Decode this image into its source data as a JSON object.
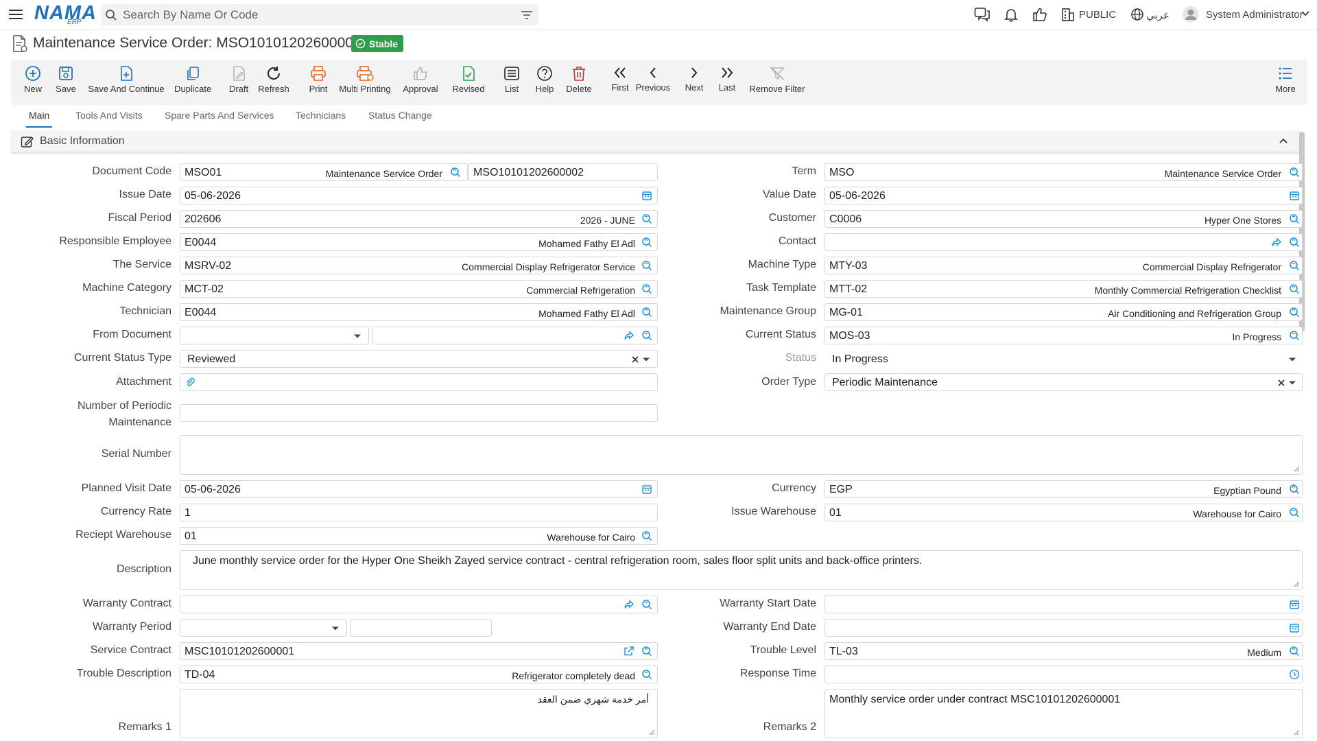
{
  "header": {
    "logo": "NAMA",
    "logo_sub": "ERP",
    "search_placeholder": "Search By Name Or Code",
    "public_label": "PUBLIC",
    "language_label": "عربي",
    "user_name": "System Administrator"
  },
  "page": {
    "title": "Maintenance Service Order: MSO10101202600002",
    "status": "Stable"
  },
  "toolbar": {
    "new": "New",
    "save": "Save",
    "save_continue": "Save And Continue",
    "duplicate": "Duplicate",
    "draft": "Draft",
    "refresh": "Refresh",
    "print": "Print",
    "multi_print": "Multi Printing",
    "approval": "Approval",
    "revised": "Revised",
    "list": "List",
    "help": "Help",
    "delete": "Delete",
    "first": "First",
    "previous": "Previous",
    "next": "Next",
    "last": "Last",
    "remove_filter": "Remove Filter",
    "more": "More"
  },
  "tabs": [
    "Main",
    "Tools And Visits",
    "Spare Parts And Services",
    "Technicians",
    "Status Change"
  ],
  "section": {
    "title": "Basic Information"
  },
  "form": {
    "document_code": {
      "label": "Document Code",
      "code": "MSO01",
      "desc": "Maintenance Service Order",
      "number": "MSO10101202600002"
    },
    "issue_date": {
      "label": "Issue Date",
      "value": "05-06-2026"
    },
    "fiscal_period": {
      "label": "Fiscal Period",
      "code": "202606",
      "desc": "2026 - JUNE"
    },
    "responsible_employee": {
      "label": "Responsible Employee",
      "code": "E0044",
      "desc": "Mohamed Fathy El Adl"
    },
    "the_service": {
      "label": "The Service",
      "code": "MSRV-02",
      "desc": "Commercial Display Refrigerator Service"
    },
    "machine_category": {
      "label": "Machine Category",
      "code": "MCT-02",
      "desc": "Commercial Refrigeration"
    },
    "technician": {
      "label": "Technician",
      "code": "E0044",
      "desc": "Mohamed Fathy El Adl"
    },
    "from_document": {
      "label": "From Document"
    },
    "current_status_type": {
      "label": "Current Status Type",
      "value": "Reviewed"
    },
    "attachment": {
      "label": "Attachment"
    },
    "periodic_maintenance": {
      "label": "Number of Periodic Maintenance"
    },
    "serial_number": {
      "label": "Serial Number"
    },
    "planned_visit_date": {
      "label": "Planned Visit Date",
      "value": "05-06-2026"
    },
    "currency_rate": {
      "label": "Currency Rate",
      "value": "1"
    },
    "receipt_warehouse": {
      "label": "Reciept Warehouse",
      "code": "01",
      "desc": "Warehouse for Cairo"
    },
    "description": {
      "label": "Description",
      "value": "June monthly service order for the Hyper One Sheikh Zayed service contract - central refrigeration room, sales floor split units and back-office printers."
    },
    "warranty_contract": {
      "label": "Warranty Contract"
    },
    "warranty_period": {
      "label": "Warranty Period"
    },
    "service_contract": {
      "label": "Service Contract",
      "value": "MSC10101202600001"
    },
    "trouble_description": {
      "label": "Trouble Description",
      "code": "TD-04",
      "desc": "Refrigerator completely dead"
    },
    "remarks1": {
      "label": "Remarks 1",
      "value": "أمر خدمة شهري ضمن العقد"
    },
    "term": {
      "label": "Term",
      "code": "MSO",
      "desc": "Maintenance Service Order"
    },
    "value_date": {
      "label": "Value Date",
      "value": "05-06-2026"
    },
    "customer": {
      "label": "Customer",
      "code": "C0006",
      "desc": "Hyper One Stores"
    },
    "contact": {
      "label": "Contact"
    },
    "machine_type": {
      "label": "Machine Type",
      "code": "MTY-03",
      "desc": "Commercial Display Refrigerator"
    },
    "task_template": {
      "label": "Task Template",
      "code": "MTT-02",
      "desc": "Monthly Commercial Refrigeration Checklist"
    },
    "maintenance_group": {
      "label": "Maintenance Group",
      "code": "MG-01",
      "desc": "Air Conditioning and Refrigeration Group"
    },
    "current_status": {
      "label": "Current Status",
      "code": "MOS-03",
      "desc": "In Progress"
    },
    "status": {
      "label": "Status",
      "value": "In Progress"
    },
    "order_type": {
      "label": "Order Type",
      "value": "Periodic Maintenance"
    },
    "currency": {
      "label": "Currency",
      "code": "EGP",
      "desc": "Egyptian Pound"
    },
    "issue_warehouse": {
      "label": "Issue Warehouse",
      "code": "01",
      "desc": "Warehouse for Cairo"
    },
    "warranty_start_date": {
      "label": "Warranty Start Date"
    },
    "warranty_end_date": {
      "label": "Warranty End Date"
    },
    "trouble_level": {
      "label": "Trouble Level",
      "code": "TL-03",
      "desc": "Medium"
    },
    "response_time": {
      "label": "Response Time"
    },
    "remarks2": {
      "label": "Remarks 2",
      "value": "Monthly service order under contract MSC10101202600001"
    }
  },
  "colors": {
    "accent": "#1f6fbf",
    "stable_badge": "#2e9e4e",
    "print_icon": "#e06a2b",
    "delete_icon": "#c0392b",
    "revised_icon": "#2e9e4e"
  }
}
